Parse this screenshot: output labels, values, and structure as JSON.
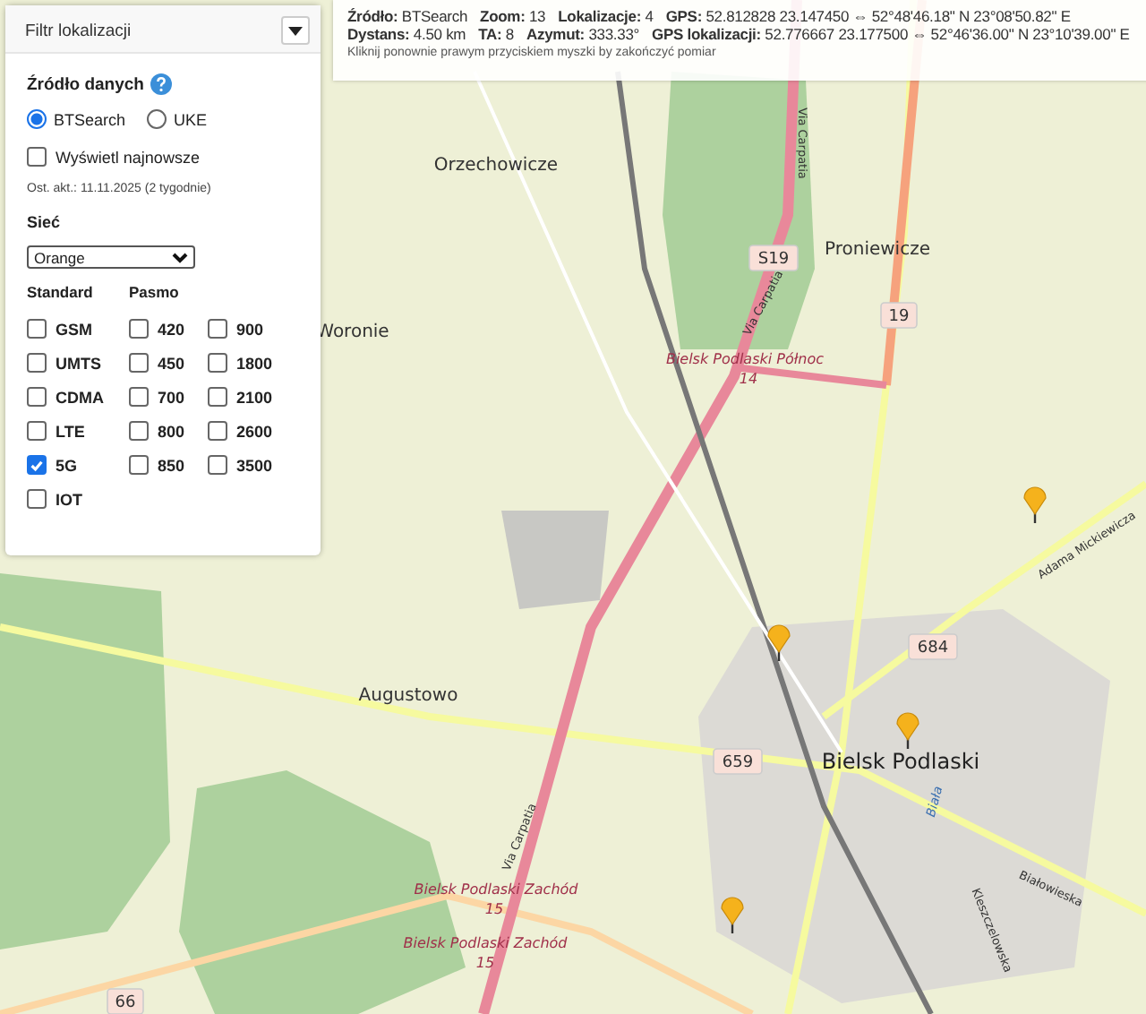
{
  "filter": {
    "title": "Filtr lokalizacji",
    "source_label": "Źródło danych",
    "sources": [
      {
        "label": "BTSearch",
        "selected": true
      },
      {
        "label": "UKE",
        "selected": false
      }
    ],
    "show_newest": {
      "label": "Wyświetl najnowsze",
      "checked": false
    },
    "updated": "Ost. akt.: 11.11.2025 (2 tygodnie)",
    "network_label": "Sieć",
    "network": "Orange",
    "standard_label": "Standard",
    "band_label": "Pasmo",
    "standards": [
      {
        "label": "GSM",
        "checked": false
      },
      {
        "label": "UMTS",
        "checked": false
      },
      {
        "label": "CDMA",
        "checked": false
      },
      {
        "label": "LTE",
        "checked": false
      },
      {
        "label": "5G",
        "checked": true
      },
      {
        "label": "IOT",
        "checked": false
      }
    ],
    "bands": [
      {
        "label": "420",
        "checked": false
      },
      {
        "label": "450",
        "checked": false
      },
      {
        "label": "700",
        "checked": false
      },
      {
        "label": "800",
        "checked": false
      },
      {
        "label": "850",
        "checked": false
      },
      {
        "label": "900",
        "checked": false
      },
      {
        "label": "1800",
        "checked": false
      },
      {
        "label": "2100",
        "checked": false
      },
      {
        "label": "2600",
        "checked": false
      },
      {
        "label": "3500",
        "checked": false
      }
    ]
  },
  "info": {
    "lines": [
      [
        {
          "label": "Źródło:",
          "value": "BTSearch"
        },
        {
          "label": "Zoom:",
          "value": "13"
        },
        {
          "label": "Lokalizacje:",
          "value": "4"
        },
        {
          "label": "GPS:",
          "value": "52.812828 23.147450 ⇔ 52°48'46.18\" N 23°08'50.82\" E"
        }
      ],
      [
        {
          "label": "Dystans:",
          "value": "4.50 km"
        },
        {
          "label": "TA:",
          "value": "8"
        },
        {
          "label": "Azymut:",
          "value": "333.33°"
        },
        {
          "label": "GPS lokalizacji:",
          "value": "52.776667 23.177500 ⇔ 52°46'36.00\" N 23°10'39.00\" E"
        }
      ]
    ],
    "hint": "Kliknij ponownie prawym przyciskiem myszki by zakończyć pomiar"
  },
  "map_labels": [
    {
      "text": "Orzechowicze",
      "kind": "town"
    },
    {
      "text": "Proniewicze",
      "kind": "town"
    },
    {
      "text": "Woronie",
      "kind": "town"
    },
    {
      "text": "Augustowo",
      "kind": "town"
    },
    {
      "text": "Bielsk Podlaski",
      "kind": "city"
    },
    {
      "text": "S19",
      "kind": "shield"
    },
    {
      "text": "19",
      "kind": "shield"
    },
    {
      "text": "684",
      "kind": "shield"
    },
    {
      "text": "659",
      "kind": "shield"
    },
    {
      "text": "66",
      "kind": "shield"
    },
    {
      "text": "Bielsk Podlaski Północ",
      "kind": "junction"
    },
    {
      "text": "14",
      "kind": "junction"
    },
    {
      "text": "Bielsk Podlaski Zachód",
      "kind": "junction"
    },
    {
      "text": "15",
      "kind": "junction"
    },
    {
      "text": "Bielsk Podlaski Zachód",
      "kind": "junction"
    },
    {
      "text": "15",
      "kind": "junction"
    },
    {
      "text": "Via Carpatia",
      "kind": "street"
    },
    {
      "text": "Via Carpatia",
      "kind": "street"
    },
    {
      "text": "Via Carpatia",
      "kind": "street"
    },
    {
      "text": "Adama Mickiewicza",
      "kind": "street"
    },
    {
      "text": "Białowieska",
      "kind": "street"
    },
    {
      "text": "Kleszczelowska",
      "kind": "street"
    },
    {
      "text": "Biała",
      "kind": "river"
    }
  ]
}
